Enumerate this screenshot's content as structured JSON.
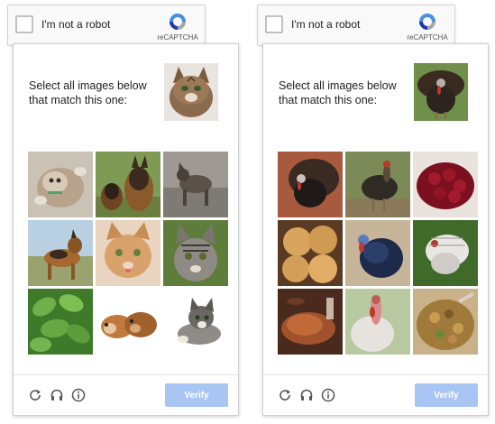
{
  "captchas": [
    {
      "robot_label": "I'm not a robot",
      "brand": "reCAPTCHA",
      "prompt": "Select all images below that match this one:",
      "verify_label": "Verify"
    },
    {
      "robot_label": "I'm not a robot",
      "brand": "reCAPTCHA",
      "prompt": "Select all images below that match this one:",
      "verify_label": "Verify"
    }
  ],
  "colors": {
    "verify_bg": "#a9c5f3",
    "recaptcha_blue": "#4a90e2",
    "recaptcha_gray": "#a6a6a6"
  },
  "icons": [
    "reload-icon",
    "headphones-icon",
    "info-icon",
    "recaptcha-logo-icon"
  ]
}
